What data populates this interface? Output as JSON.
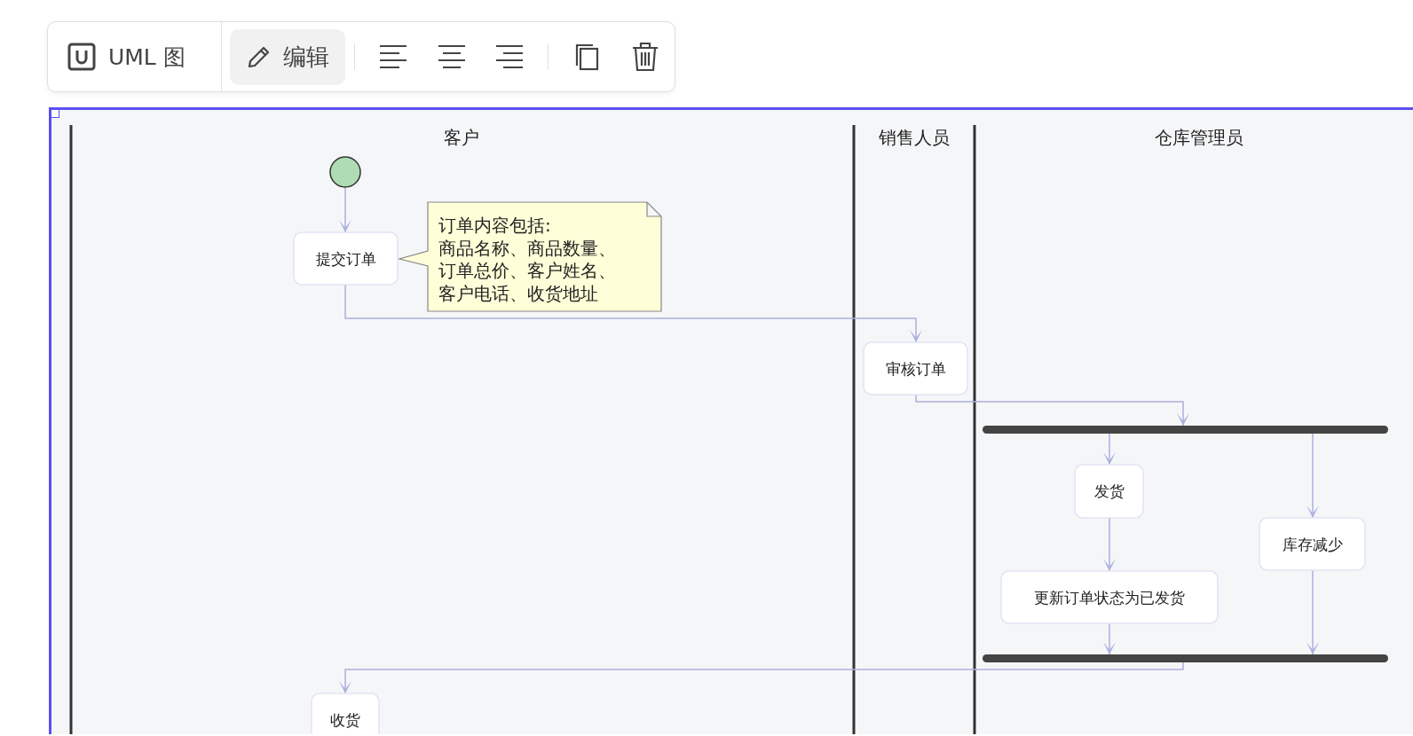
{
  "toolbar": {
    "diagram_type": {
      "label": "UML 图"
    },
    "edit_button": {
      "label": "编辑",
      "active": true
    }
  },
  "diagram": {
    "lanes": [
      {
        "title": "客户"
      },
      {
        "title": "销售人员"
      },
      {
        "title": "仓库管理员"
      }
    ],
    "activities": [
      {
        "label": "提交订单"
      },
      {
        "label": "审核订单"
      },
      {
        "label": "发货"
      },
      {
        "label": "更新订单状态为已发货"
      },
      {
        "label": "库存减少"
      },
      {
        "label": "收货"
      }
    ],
    "note": {
      "lines": [
        "订单内容包括:",
        "商品名称、商品数量、",
        "订单总价、客户姓名、",
        "客户电话、收货地址"
      ]
    }
  }
}
